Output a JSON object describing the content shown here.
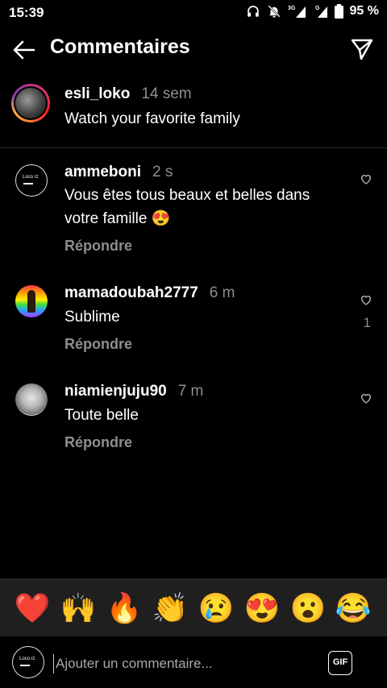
{
  "status": {
    "time": "15:39",
    "battery": "95 %",
    "network": "3G"
  },
  "header": {
    "title": "Commentaires"
  },
  "caption": {
    "username": "esli_loko",
    "time": "14 sem",
    "text": "Watch your favorite family"
  },
  "comments": [
    {
      "username": "ammeboni",
      "time": "2 s",
      "text": "Vous êtes tous beaux et belles dans votre famille 😍",
      "reply": "Répondre",
      "likes": ""
    },
    {
      "username": "mamadoubah2777",
      "time": "6 m",
      "text": "Sublime",
      "reply": "Répondre",
      "likes": "1"
    },
    {
      "username": "niamienjuju90",
      "time": "7 m",
      "text": "Toute belle",
      "reply": "Répondre",
      "likes": ""
    }
  ],
  "emoji_bar": [
    "❤️",
    "🙌",
    "🔥",
    "👏",
    "😢",
    "😍",
    "😮",
    "😂"
  ],
  "input": {
    "placeholder": "Ajouter un commentaire...",
    "gif_label": "GIF"
  },
  "avatar_logo_text": "Loco rz"
}
